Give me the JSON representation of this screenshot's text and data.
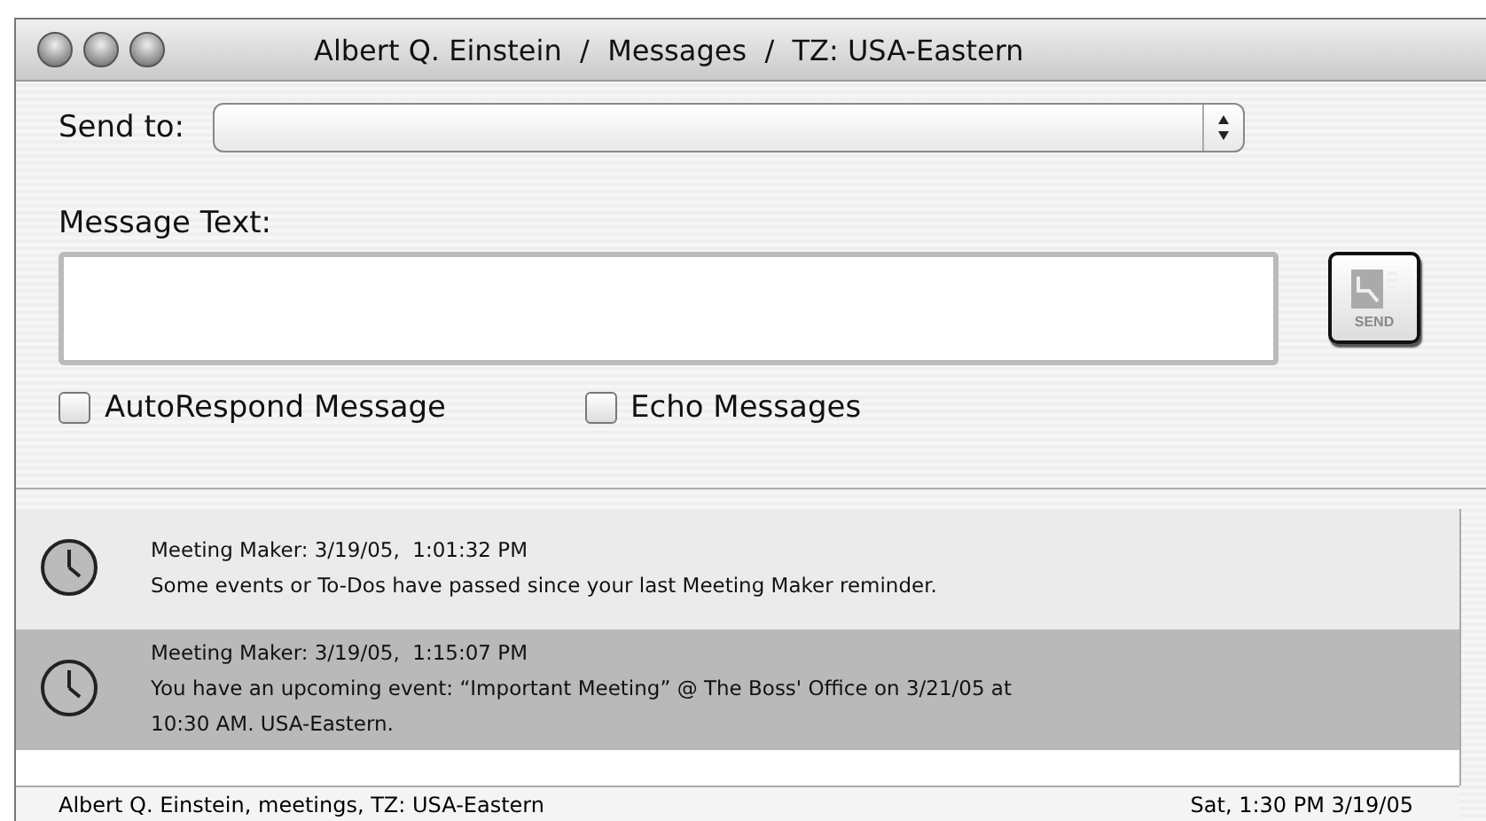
{
  "window": {
    "title": "Albert Q. Einstein  /  Messages  /  TZ: USA-Eastern"
  },
  "send_to": {
    "label": "Send to:"
  },
  "message_text": {
    "label": "Message Text:"
  },
  "send_button": {
    "label": "SEND"
  },
  "options": [
    {
      "label": "AutoRespond Message",
      "checked": false
    },
    {
      "label": "Echo Messages",
      "checked": false
    }
  ],
  "messages": [
    {
      "header": "Meeting Maker: 3/19/05,  1:01:32 PM",
      "body": "Some events or To-Dos have passed since your last Meeting Maker reminder.",
      "selected": false
    },
    {
      "header": "Meeting Maker: 3/19/05,  1:15:07 PM",
      "body": "You have an upcoming event: “Important Meeting” @ The Boss' Office on 3/21/05 at 10:30 AM. USA-Eastern.",
      "selected": true
    }
  ],
  "status_bar": {
    "left": "Albert Q. Einstein, meetings, TZ: USA-Eastern",
    "right": "Sat,  1:30 PM  3/19/05"
  }
}
